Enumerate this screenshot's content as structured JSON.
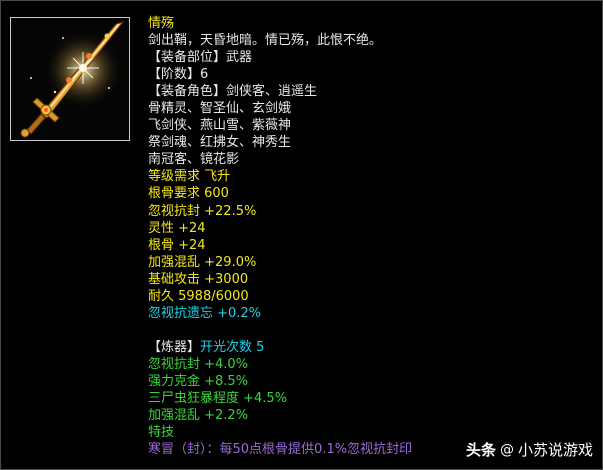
{
  "colors": {
    "yellow": "#f5e61e",
    "white": "#e8e8e8",
    "green": "#39d639",
    "cyan": "#19d5e8",
    "purple": "#9b6ad6"
  },
  "item": {
    "name": "情殇",
    "icon": "golden-sword-icon",
    "lines": [
      {
        "text": "剑出鞘，天昏地暗。情已殇，此恨不绝。",
        "color": "white"
      },
      {
        "text": "【装备部位】武器",
        "color": "white"
      },
      {
        "text": "【阶数】6",
        "color": "white"
      },
      {
        "text": "【装备角色】剑侠客、逍遥生",
        "color": "white"
      },
      {
        "text": "骨精灵、智圣仙、玄剑娥",
        "color": "white"
      },
      {
        "text": "飞剑侠、燕山雪、紫薇神",
        "color": "white"
      },
      {
        "text": "祭剑魂、红拂女、神秀生",
        "color": "white"
      },
      {
        "text": "南冠客、镜花影",
        "color": "white"
      },
      {
        "text": "等级需求 飞升",
        "color": "yellow"
      },
      {
        "text": "根骨要求 600",
        "color": "yellow"
      },
      {
        "text": "忽视抗封 +22.5%",
        "color": "yellow"
      },
      {
        "text": "灵性 +24",
        "color": "yellow"
      },
      {
        "text": "根骨 +24",
        "color": "yellow"
      },
      {
        "text": "加强混乱 +29.0%",
        "color": "yellow"
      },
      {
        "text": "基础攻击 +3000",
        "color": "yellow"
      },
      {
        "text": "耐久 5988/6000",
        "color": "yellow"
      },
      {
        "text": "忽视抗遗忘 +0.2%",
        "color": "cyan"
      },
      {
        "text": "",
        "color": "white"
      },
      {
        "text": "【炼器】开光次数 5",
        "color": "white",
        "segments": [
          {
            "text": "【炼器】",
            "color": "white"
          },
          {
            "text": "开光次数 5",
            "color": "cyan"
          }
        ]
      },
      {
        "text": "忽视抗封 +4.0%",
        "color": "green"
      },
      {
        "text": "强力克金 +8.5%",
        "color": "green"
      },
      {
        "text": "三尸虫狂暴程度 +4.5%",
        "color": "green"
      },
      {
        "text": "加强混乱 +2.2%",
        "color": "green"
      },
      {
        "text": "特技",
        "color": "green"
      },
      {
        "text": "寒冒（封）：每50点根骨提供0.1%忽视抗封印",
        "color": "purple"
      }
    ]
  },
  "watermark": {
    "brand": "头条",
    "at": "@",
    "author": "小苏说游戏"
  }
}
